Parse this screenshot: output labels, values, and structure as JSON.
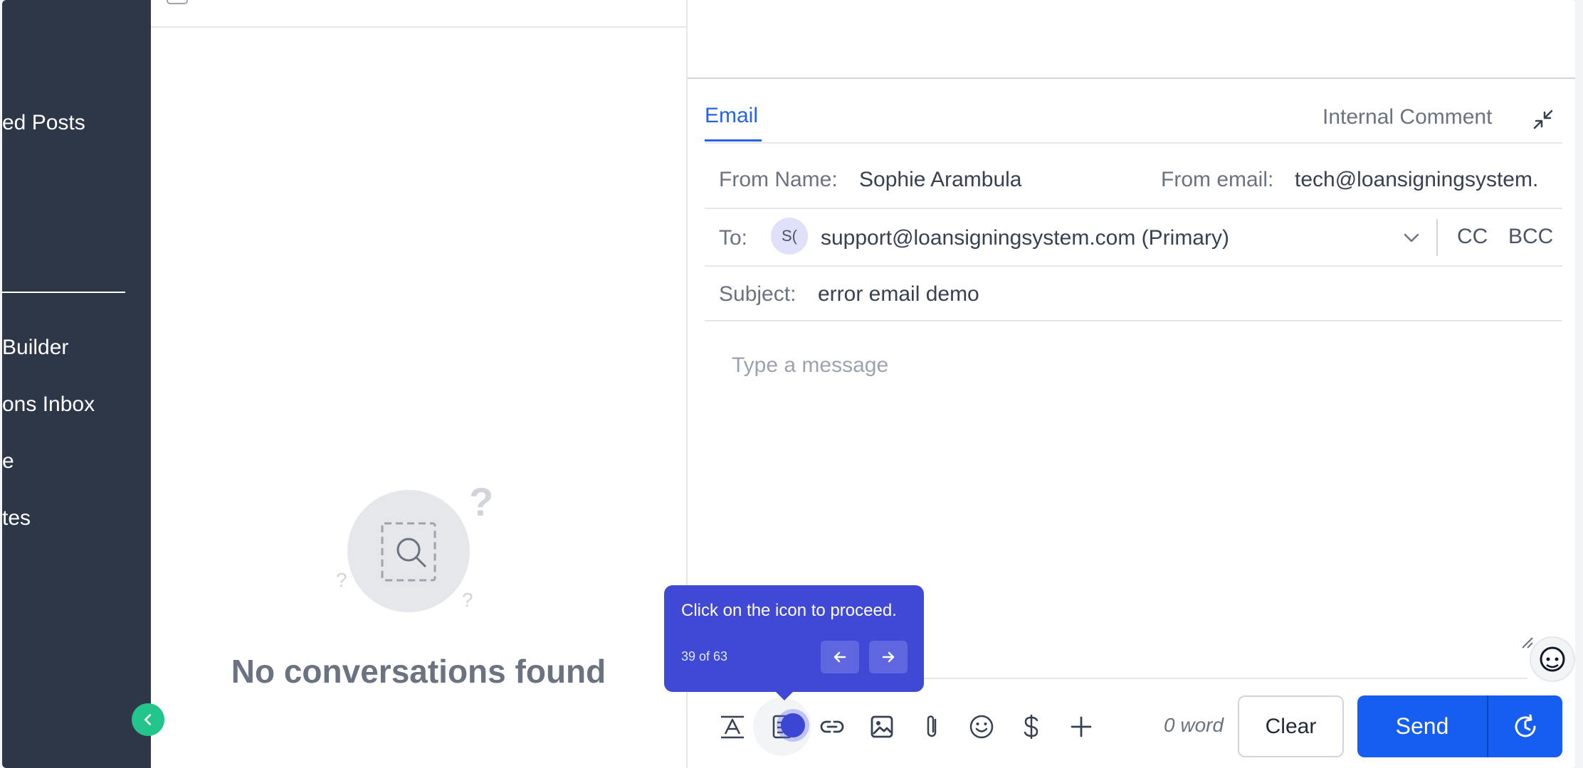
{
  "sidebar": {
    "items": [
      {
        "label": "ed Posts"
      },
      {
        "label": "Builder"
      },
      {
        "label": "ons Inbox"
      },
      {
        "label": "e"
      },
      {
        "label": "tes"
      }
    ]
  },
  "conversations": {
    "empty_title": "No conversations found"
  },
  "composer": {
    "tabs": {
      "email": "Email",
      "internal": "Internal Comment"
    },
    "from_name_label": "From Name:",
    "from_name_value": "Sophie Arambula",
    "from_email_label": "From email:",
    "from_email_value": "tech@loansigningsystem.",
    "to_label": "To:",
    "to_avatar": "S(",
    "to_value": "support@loansigningsystem.com (Primary)",
    "cc_label": "CC",
    "bcc_label": "BCC",
    "subject_label": "Subject:",
    "subject_value": "error email demo",
    "message_placeholder": "Type a message",
    "word_count": "0 word",
    "clear_label": "Clear",
    "send_label": "Send"
  },
  "toolbar": {
    "icons": [
      "text-format-icon",
      "snippet-icon",
      "link-icon",
      "image-icon",
      "attachment-icon",
      "emoji-icon",
      "dollar-icon",
      "plus-icon"
    ]
  },
  "tooltip": {
    "text": "Click on the icon to proceed.",
    "step": "39 of 63"
  },
  "colors": {
    "sidebar_bg": "#2d3748",
    "accent": "#155eef",
    "tooltip_bg": "#4048d6",
    "collapse_button": "#22c58b"
  }
}
